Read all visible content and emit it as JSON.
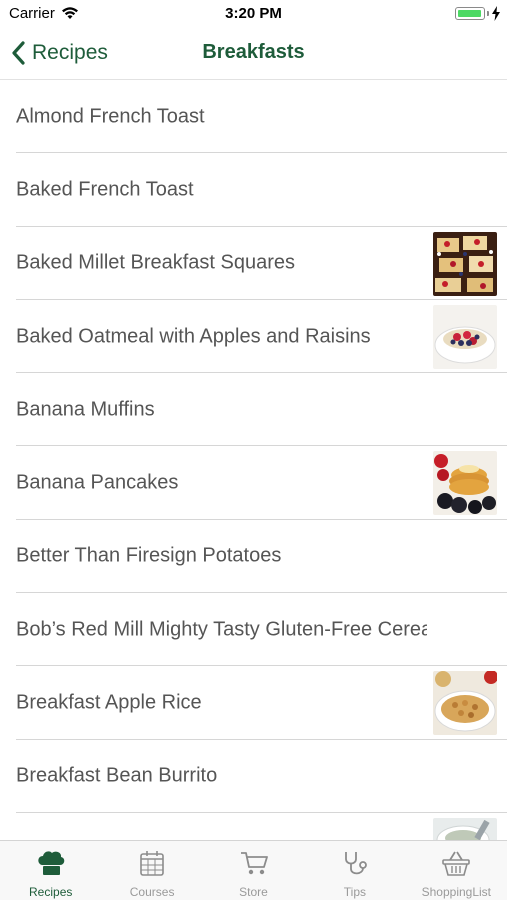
{
  "status_bar": {
    "carrier": "Carrier",
    "time": "3:20 PM",
    "battery_level": 0.95,
    "battery_color": "#4cd964"
  },
  "nav": {
    "back_label": "Recipes",
    "title": "Breakfasts",
    "accent_color": "#1e5c3a"
  },
  "recipes": [
    {
      "title": "Almond French Toast",
      "thumbnail": null
    },
    {
      "title": "Baked French Toast",
      "thumbnail": null
    },
    {
      "title": "Baked Millet Breakfast Squares",
      "thumbnail": "millet-squares-photo"
    },
    {
      "title": "Baked Oatmeal with Apples and Raisins",
      "thumbnail": "oatmeal-bowl-photo"
    },
    {
      "title": "Banana Muffins",
      "thumbnail": null
    },
    {
      "title": "Banana Pancakes",
      "thumbnail": "pancakes-berries-photo"
    },
    {
      "title": "Better Than Firesign Potatoes",
      "thumbnail": null
    },
    {
      "title": "Bob’s Red Mill Mighty Tasty Gluten-Free Cereal",
      "thumbnail": null
    },
    {
      "title": "Breakfast Apple Rice",
      "thumbnail": "apple-rice-bowl-photo"
    },
    {
      "title": "Breakfast Bean Burrito",
      "thumbnail": null
    },
    {
      "title": "",
      "thumbnail": "partial-dish-photo"
    }
  ],
  "tabs": [
    {
      "label": "Recipes",
      "icon": "chef-hat-icon",
      "active": true
    },
    {
      "label": "Courses",
      "icon": "calendar-icon",
      "active": false
    },
    {
      "label": "Store",
      "icon": "cart-icon",
      "active": false
    },
    {
      "label": "Tips",
      "icon": "stethoscope-icon",
      "active": false
    },
    {
      "label": "ShoppingList",
      "icon": "basket-icon",
      "active": false
    }
  ]
}
